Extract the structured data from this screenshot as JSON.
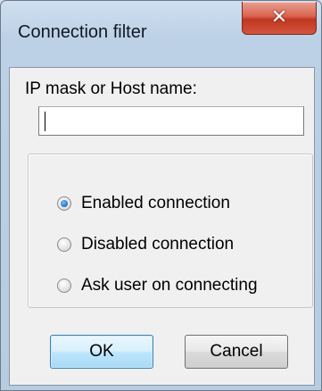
{
  "window": {
    "title": "Connection filter",
    "close_glyph": "✕"
  },
  "form": {
    "ip_label": "IP mask or Host name:",
    "ip_value": ""
  },
  "options": [
    {
      "label": "Enabled connection",
      "checked": true
    },
    {
      "label": "Disabled connection",
      "checked": false
    },
    {
      "label": "Ask user on connecting",
      "checked": false
    }
  ],
  "buttons": {
    "ok_label": "OK",
    "cancel_label": "Cancel"
  },
  "colors": {
    "frame": "#b7cbe1",
    "close_button": "#c1361f",
    "default_button_border": "#3c7fb1",
    "radio_selected": "#1f6fc6"
  },
  "icons": {
    "close": "close-icon",
    "radio_selected": "radio-selected-icon"
  }
}
